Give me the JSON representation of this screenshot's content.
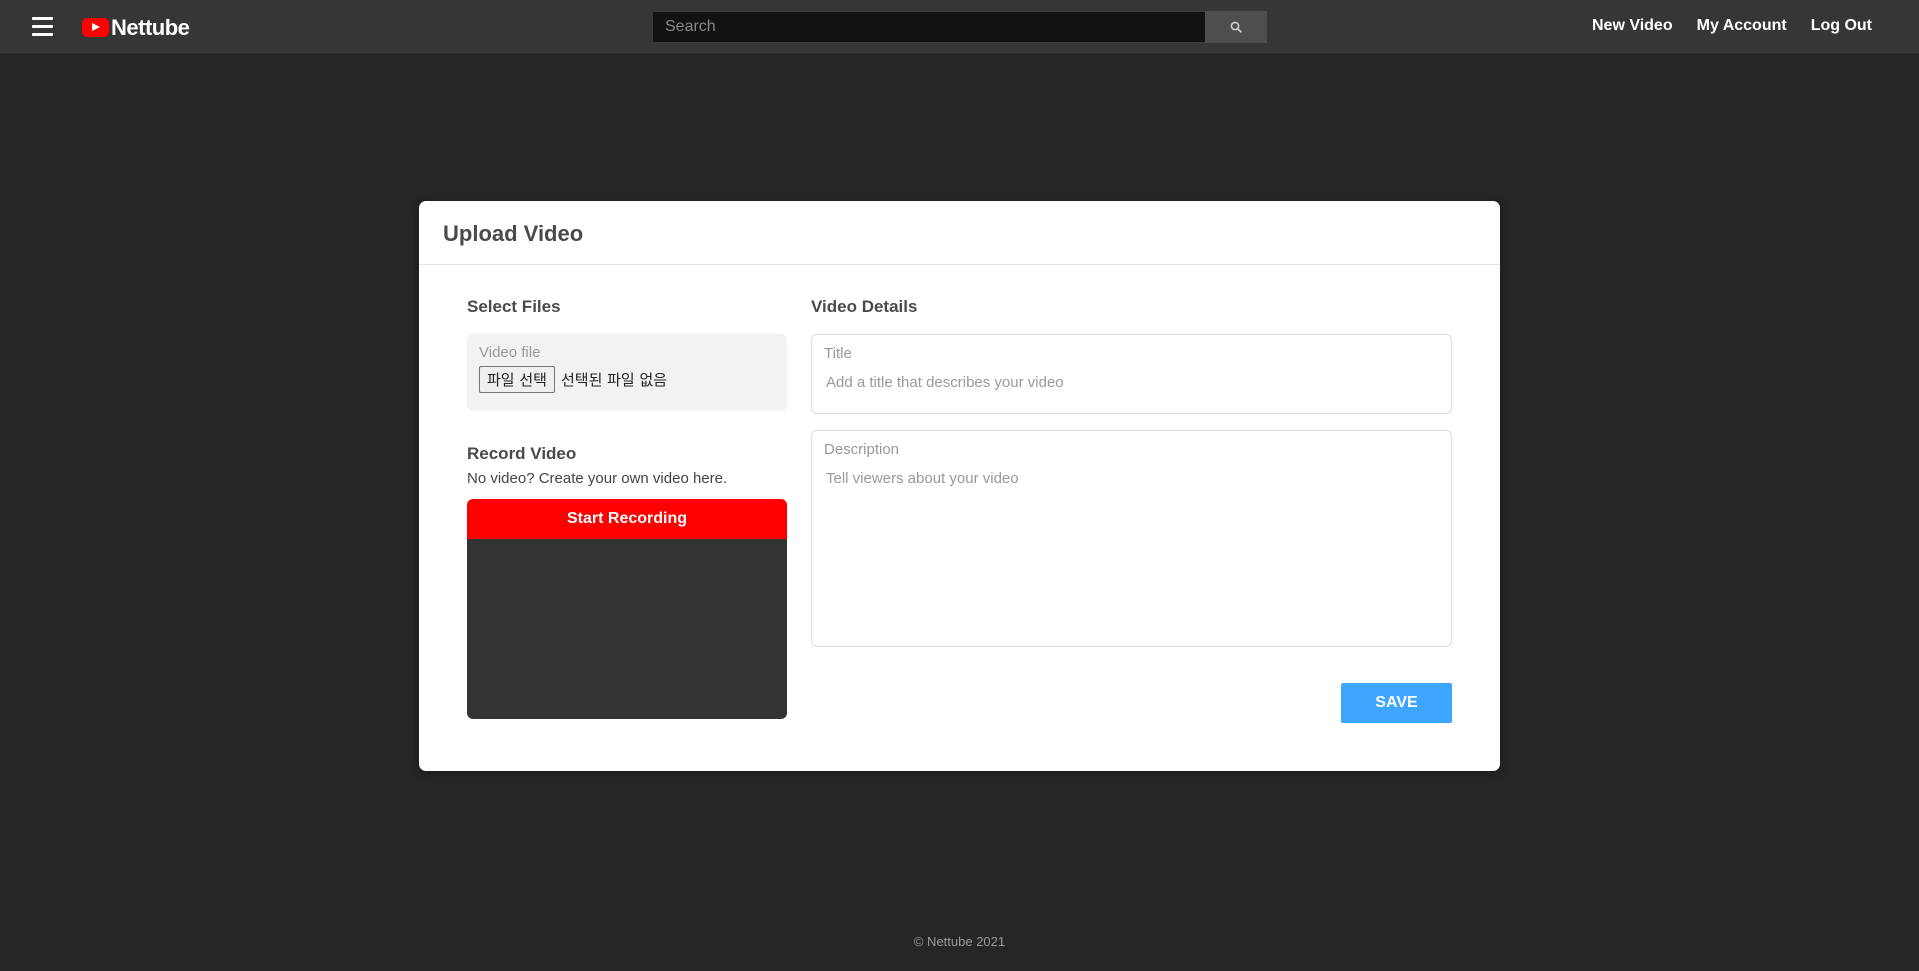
{
  "header": {
    "logo_text": "Nettube",
    "search_placeholder": "Search",
    "nav": [
      "New Video",
      "My Account",
      "Log Out"
    ]
  },
  "upload": {
    "title": "Upload Video",
    "select_files": {
      "title": "Select Files",
      "label": "Video file",
      "button": "파일 선택",
      "no_file": "선택된 파일 없음"
    },
    "record": {
      "title": "Record Video",
      "subtitle": "No video? Create your own video here.",
      "button": "Start Recording"
    },
    "details": {
      "title": "Video Details",
      "title_label": "Title",
      "title_placeholder": "Add a title that describes your video",
      "desc_label": "Description",
      "desc_placeholder": "Tell viewers about your video"
    },
    "save": "SAVE"
  },
  "footer": "© Nettube 2021",
  "colors": {
    "brand_red": "#ff0000",
    "save_blue": "#3ea6ff",
    "background": "#262626"
  }
}
